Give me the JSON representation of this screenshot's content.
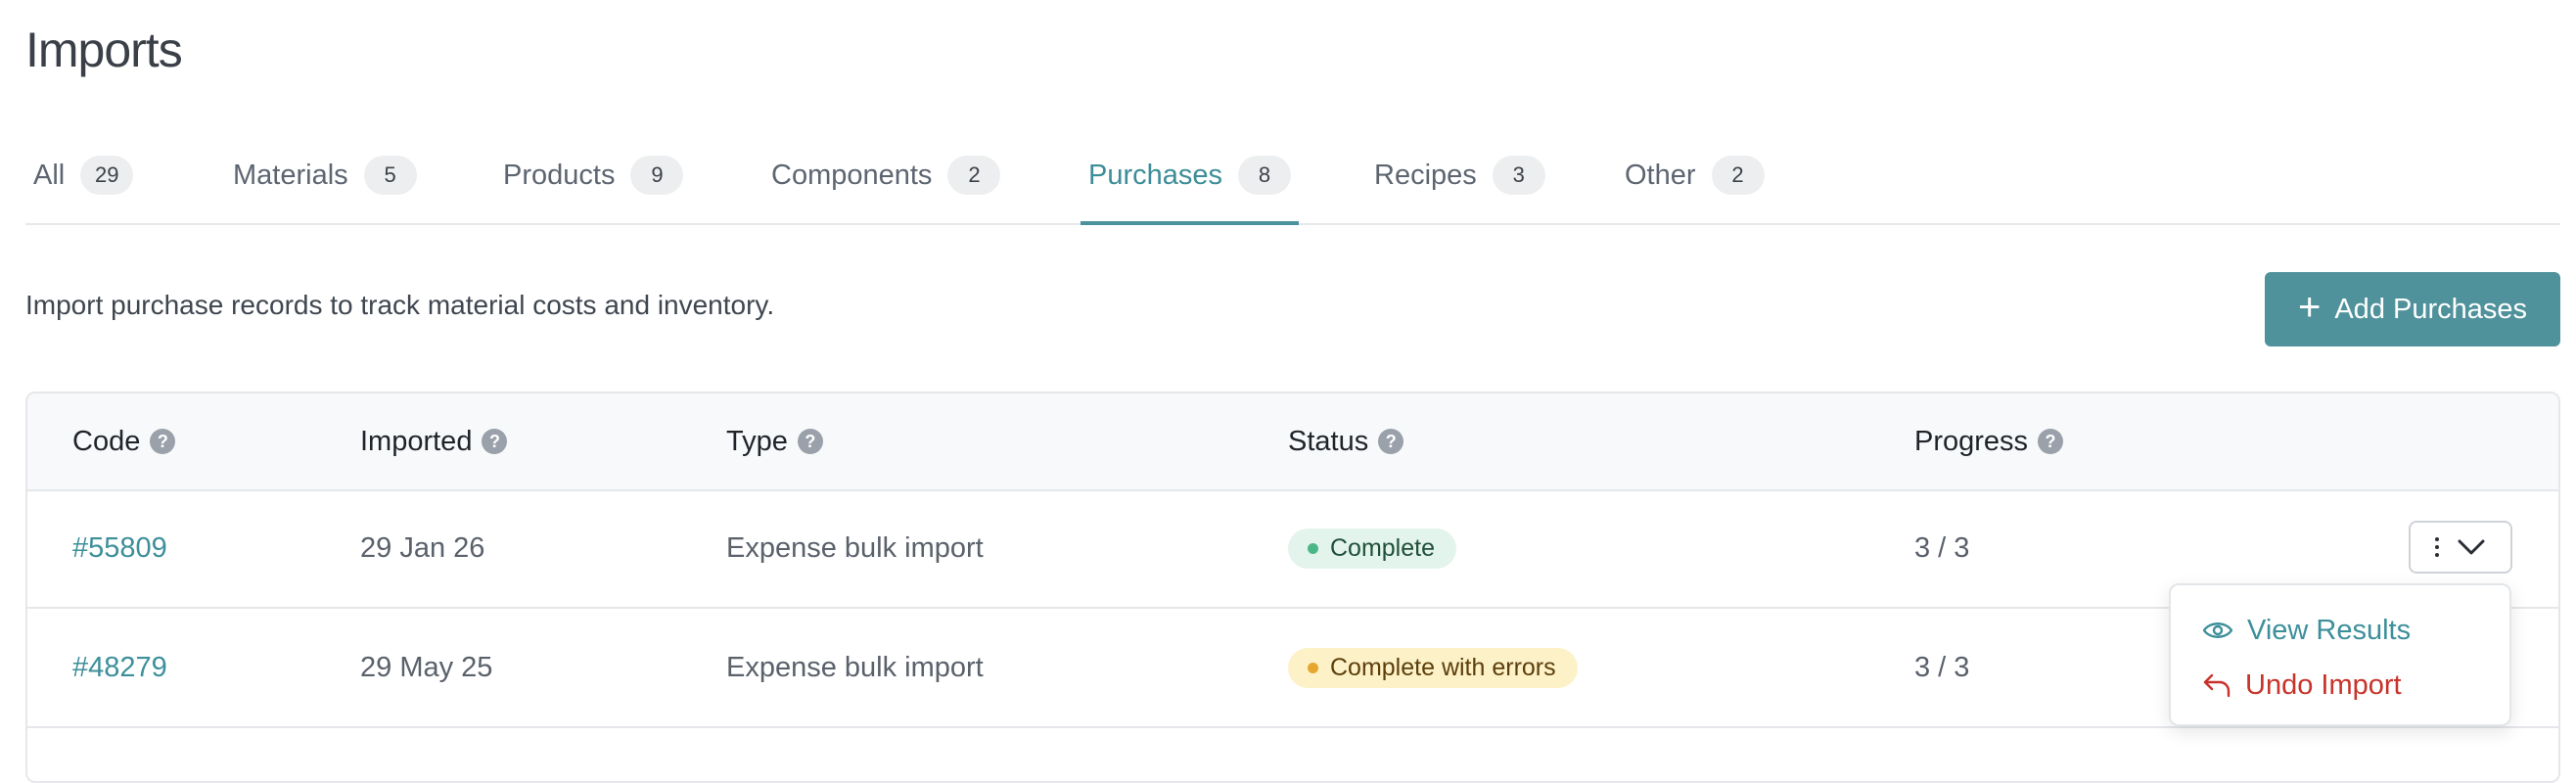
{
  "page": {
    "title": "Imports"
  },
  "tabs": [
    {
      "label": "All",
      "count": "29",
      "active": false
    },
    {
      "label": "Materials",
      "count": "5",
      "active": false
    },
    {
      "label": "Products",
      "count": "9",
      "active": false
    },
    {
      "label": "Components",
      "count": "2",
      "active": false
    },
    {
      "label": "Purchases",
      "count": "8",
      "active": true
    },
    {
      "label": "Recipes",
      "count": "3",
      "active": false
    },
    {
      "label": "Other",
      "count": "2",
      "active": false
    }
  ],
  "description": "Import purchase records to track material costs and inventory.",
  "add_button": {
    "icon": "plus-icon",
    "label": "Add Purchases"
  },
  "table": {
    "columns": [
      "Code",
      "Imported",
      "Type",
      "Status",
      "Progress"
    ],
    "rows": [
      {
        "code": "#55809",
        "imported": "29 Jan 26",
        "type": "Expense bulk import",
        "status": "Complete",
        "progress": "3 / 3"
      },
      {
        "code": "#48279",
        "imported": "29 May 25",
        "type": "Expense bulk import",
        "status": "Complete with errors",
        "progress": "3 / 3"
      }
    ]
  },
  "row_actions_menu": {
    "items": [
      {
        "label": "View Results",
        "icon": "eye-icon"
      },
      {
        "label": "Undo Import",
        "icon": "undo-icon"
      }
    ]
  },
  "colors": {
    "accent": "#4f929b",
    "link": "#3d8f9a",
    "danger": "#c7332a",
    "status_complete": "#4cb786",
    "status_warning": "#e6a72e"
  }
}
